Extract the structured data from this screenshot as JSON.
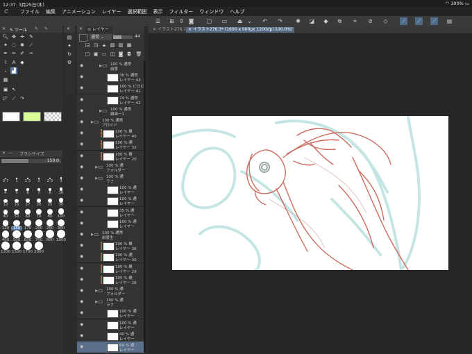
{
  "status": {
    "time": "12:37",
    "date": "3月25日(木)",
    "battery": "100%"
  },
  "menu": [
    "ファイル",
    "編集",
    "アニメーション",
    "レイヤー",
    "選択範囲",
    "表示",
    "フィルター",
    "ウィンドウ",
    "ヘルプ"
  ],
  "tool_panel": {
    "tab_label": "ツール"
  },
  "brush_size_panel": {
    "title": "ブラシサイズ",
    "value": "150.0",
    "sizes": [
      "0.7",
      "1",
      "1.5",
      "2",
      "2.5",
      "3",
      "4",
      "5",
      "6",
      "7",
      "8",
      "10",
      "12",
      "15",
      "17",
      "20",
      "25",
      "30",
      "40",
      "50",
      "60",
      "70",
      "80",
      "100",
      "120",
      "150",
      "170",
      "200",
      "250",
      "300",
      "400",
      "500",
      "600",
      "700",
      "800",
      "1000",
      "1200",
      "1500",
      "1700",
      "2000"
    ],
    "selected": "150"
  },
  "layer_panel": {
    "tab_label": "レイヤー",
    "blend_mode": "通常",
    "opacity": "44",
    "layers": [
      {
        "kind": "folder",
        "t1": "100 % 通常",
        "t2": "前景"
      },
      {
        "kind": "layer",
        "t1": "36 % 通常",
        "t2": "レイヤー 43"
      },
      {
        "kind": "layer",
        "t1": "100 % ピロピ",
        "t2": "レイヤー 41"
      },
      {
        "kind": "layer",
        "t1": "74 % 通常",
        "t2": "レイヤー 42"
      },
      {
        "kind": "folder",
        "t1": "100 % 通常",
        "t2": "線画ー1"
      },
      {
        "kind": "folder",
        "t1": "100 % 通常",
        "t2": "ブロイド"
      },
      {
        "kind": "layer",
        "t1": "100 % 乗",
        "t2": "レイヤー 40"
      },
      {
        "kind": "layer",
        "t1": "100 % 通",
        "t2": "レイヤー 32"
      },
      {
        "kind": "layer",
        "t1": "100 % 乗",
        "t2": "レイヤー 20"
      },
      {
        "kind": "folder",
        "t1": "100 % 通",
        "t2": "フォルダー"
      },
      {
        "kind": "folder",
        "t1": "100 % 通",
        "t2": "ラフ"
      },
      {
        "kind": "layer",
        "t1": "100 % 通",
        "t2": "レイヤー"
      },
      {
        "kind": "layer",
        "t1": "100 % 通",
        "t2": "レイヤー"
      },
      {
        "kind": "layer",
        "t1": "35 % 通",
        "t2": "レイヤー"
      },
      {
        "kind": "layer",
        "t1": "100 % 通",
        "t2": "レイヤー"
      },
      {
        "kind": "folder",
        "t1": "100 % 通常",
        "t2": "前景生"
      },
      {
        "kind": "layer",
        "t1": "100 % 乗",
        "t2": "レイヤー 36"
      },
      {
        "kind": "layer",
        "t1": "100 % 通",
        "t2": "レイヤー 30"
      },
      {
        "kind": "layer",
        "t1": "100 % 乗",
        "t2": "レイヤー 29"
      },
      {
        "kind": "layer",
        "t1": "100 % 乗",
        "t2": "レイヤー 28"
      },
      {
        "kind": "folder",
        "t1": "100 % 通",
        "t2": "フォルダー"
      },
      {
        "kind": "folder",
        "t1": "100 % 通",
        "t2": "ラフ"
      },
      {
        "kind": "layer",
        "t1": "100 % 通",
        "t2": "レイヤー"
      },
      {
        "kind": "layer",
        "t1": "100 % 通",
        "t2": "レイヤー"
      },
      {
        "kind": "layer",
        "t1": "40 % 通",
        "t2": "レイヤー"
      },
      {
        "kind": "layer",
        "t1": "64 % 通",
        "t2": "レイヤー"
      }
    ]
  },
  "documents": [
    {
      "label": "イラスト276.1"
    },
    {
      "label": "イラスト276.3* (1600 x 900px 1200dpi 100.0%)"
    }
  ],
  "colors": {
    "main": "#ffffff",
    "sub": "#d9ff99",
    "accent": "#5a7ea3"
  }
}
